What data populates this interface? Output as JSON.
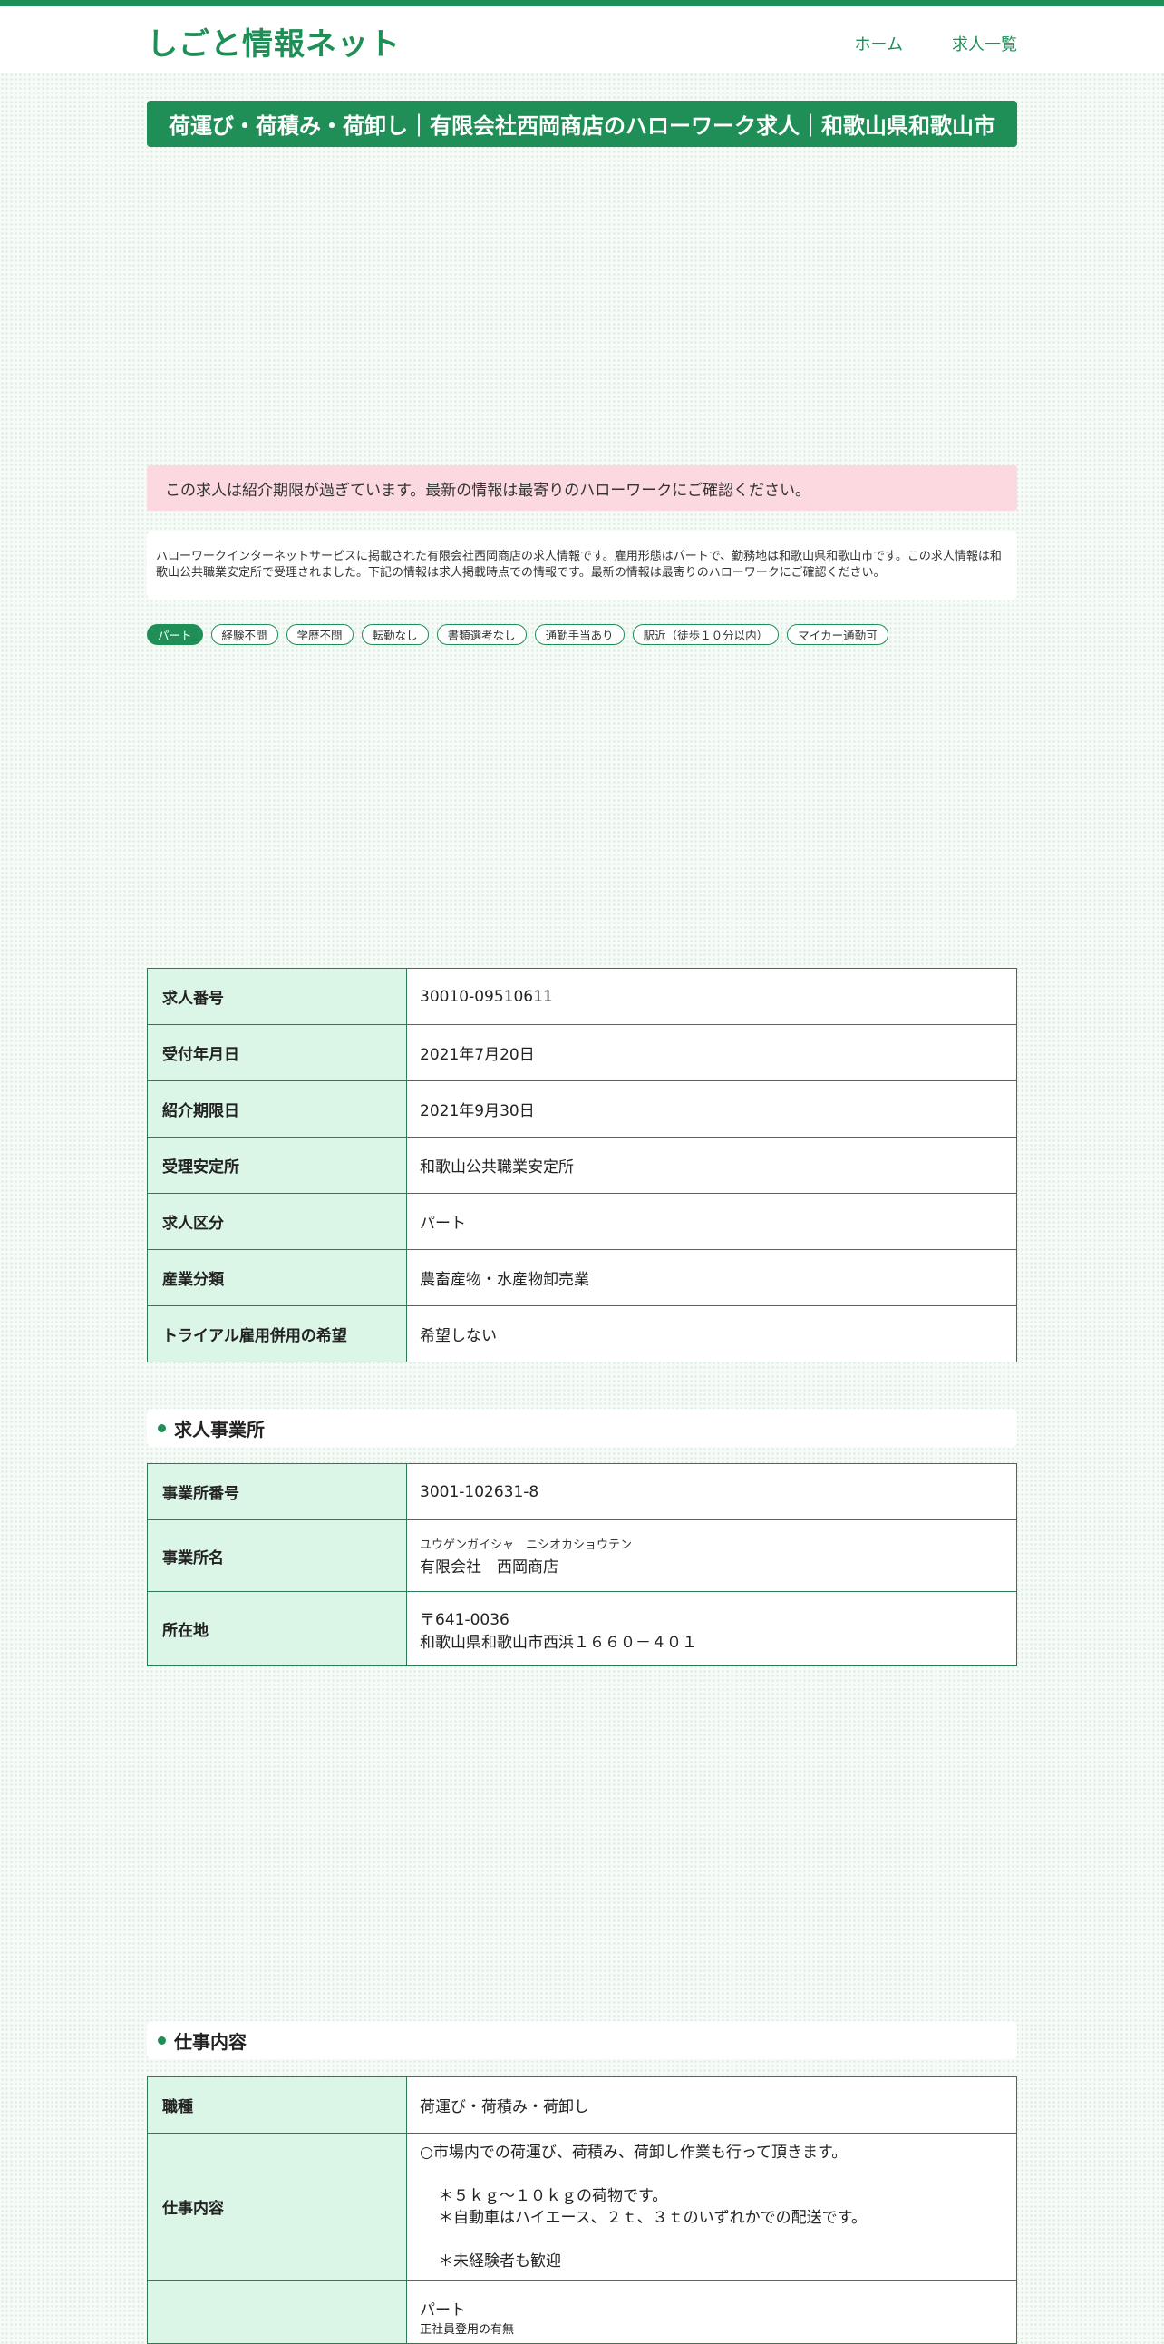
{
  "site": {
    "logo": "しごと情報ネット",
    "nav": [
      "ホーム",
      "求人一覧"
    ]
  },
  "page_title": "荷運び・荷積み・荷卸し｜有限会社西岡商店のハローワーク求人｜和歌山県和歌山市",
  "notice": "この求人は紹介期限が過ぎています。最新の情報は最寄りのハローワークにご確認ください。",
  "description": "ハローワークインターネットサービスに掲載された有限会社西岡商店の求人情報です。雇用形態はパートで、勤務地は和歌山県和歌山市です。この求人情報は和歌山公共職業安定所で受理されました。下記の情報は求人掲載時点での情報です。最新の情報は最寄りのハローワークにご確認ください。",
  "tags": [
    "パート",
    "経験不問",
    "学歴不問",
    "転勤なし",
    "書類選考なし",
    "通勤手当あり",
    "駅近（徒歩１０分以内）",
    "マイカー通勤可"
  ],
  "basic_table": [
    {
      "label": "求人番号",
      "value": "30010-09510611"
    },
    {
      "label": "受付年月日",
      "value": "2021年7月20日"
    },
    {
      "label": "紹介期限日",
      "value": "2021年9月30日"
    },
    {
      "label": "受理安定所",
      "value": "和歌山公共職業安定所"
    },
    {
      "label": "求人区分",
      "value": "パート"
    },
    {
      "label": "産業分類",
      "value": "農畜産物・水産物卸売業"
    },
    {
      "label": "トライアル雇用併用の希望",
      "value": "希望しない"
    }
  ],
  "office_section": {
    "heading": "求人事業所",
    "office_number_label": "事業所番号",
    "office_number": "3001-102631-8",
    "name_label": "事業所名",
    "name_kana": "ユウゲンガイシャ　ニシオカショウテン",
    "name": "有限会社　西岡商店",
    "address_label": "所在地",
    "postal": "〒641-0036",
    "address": "和歌山県和歌山市西浜１６６０－４０１"
  },
  "job_section": {
    "heading": "仕事内容",
    "occupation_label": "職種",
    "occupation": "荷運び・荷積み・荷卸し",
    "content_label": "仕事内容",
    "content_line1": "○市場内での荷運び、荷積み、荷卸し作業も行って頂きます。",
    "content_line2": "＊５ｋｇ～１０ｋｇの荷物です。",
    "content_line3": "＊自動車はハイエース、２ｔ、３ｔのいずれかでの配送です。",
    "content_line4": "＊未経験者も歓迎",
    "employment_value": "パート",
    "employment_sub": "正社員登用の有無"
  }
}
